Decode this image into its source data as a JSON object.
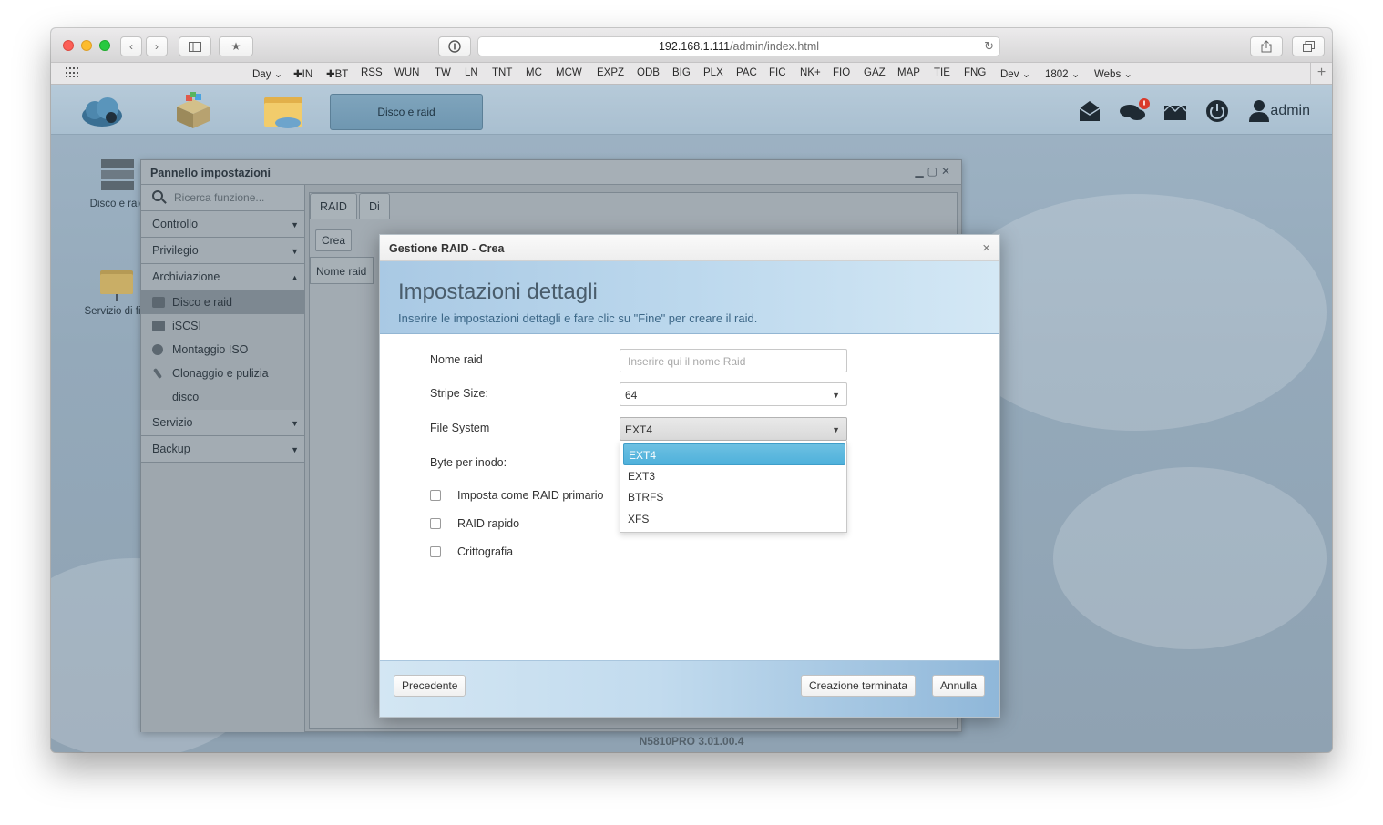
{
  "browser": {
    "url_host": "192.168.1.111",
    "url_path": "/admin/index.html",
    "bookmarks": [
      "Day ⌄",
      "✚IN",
      "✚BT",
      "RSS",
      "WUN",
      "TW",
      "LN",
      "TNT",
      "MC",
      "MCW",
      "EXPZ",
      "ODB",
      "BIG",
      "PLX",
      "PAC",
      "FIC",
      "NK+",
      "FIO",
      "GAZ",
      "MAP",
      "TIE",
      "FNG",
      "Dev ⌄",
      "1802 ⌄",
      "Webs ⌄"
    ],
    "new_tab_glyph": "+"
  },
  "topbar": {
    "active_app": "Disco e raid",
    "user": "admin"
  },
  "desktop": {
    "icon1_label": "Disco e raid",
    "icon2_label": "Servizio di file"
  },
  "panel": {
    "title": "Pannello impostazioni",
    "search_placeholder": "Ricerca funzione...",
    "sections": [
      {
        "label": "Controllo"
      },
      {
        "label": "Privilegio"
      },
      {
        "label": "Archiviazione"
      },
      {
        "label": "Servizio"
      },
      {
        "label": "Backup"
      }
    ],
    "items": [
      {
        "label": "Disco e raid"
      },
      {
        "label": "iSCSI"
      },
      {
        "label": "Montaggio ISO"
      },
      {
        "label": "Clonaggio e pulizia"
      },
      {
        "label": "disco"
      }
    ],
    "tabs": [
      "RAID",
      "Di"
    ],
    "crea_button": "Crea",
    "column_header": "Nome raid"
  },
  "modal": {
    "title": "Gestione RAID - Crea",
    "close_glyph": "×",
    "heading": "Impostazioni dettagli",
    "subheading": "Inserire le impostazioni dettagli e fare clic su \"Fine\" per creare il raid.",
    "fields": {
      "nome_raid_label": "Nome raid",
      "nome_raid_placeholder": "Inserire qui il nome Raid",
      "stripe_label": "Stripe Size:",
      "stripe_value": "64",
      "fs_label": "File System",
      "fs_value": "EXT4",
      "byte_label": "Byte per inodo:"
    },
    "fs_options": [
      "EXT4",
      "EXT3",
      "BTRFS",
      "XFS"
    ],
    "fs_selected": "EXT4",
    "checkboxes": [
      {
        "label": "Imposta come RAID primario",
        "checked": false
      },
      {
        "label": "RAID rapido",
        "checked": false
      },
      {
        "label": "Crittografia",
        "checked": false
      }
    ],
    "buttons": {
      "back": "Precedente",
      "finish": "Creazione terminata",
      "cancel": "Annulla"
    }
  },
  "footer": {
    "version": "N5810PRO   3.01.00.4"
  },
  "colors": {
    "accent_selected": "#4fb1db",
    "header_gradient_start": "#a9c9e4"
  }
}
